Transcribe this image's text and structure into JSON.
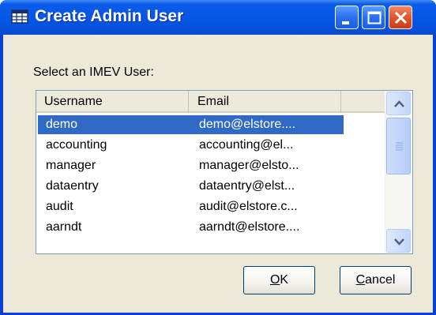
{
  "window": {
    "title": "Create Admin User",
    "title_icon": "table-icon",
    "controls": [
      "minimize",
      "maximize",
      "close"
    ]
  },
  "dialog": {
    "prompt": "Select an IMEV User:",
    "columns": [
      "Username",
      "Email"
    ],
    "rows": [
      {
        "username": "demo",
        "email": "demo@elstore....",
        "selected": true
      },
      {
        "username": "accounting",
        "email": "accounting@el...",
        "selected": false
      },
      {
        "username": "manager",
        "email": "manager@elsto...",
        "selected": false
      },
      {
        "username": "dataentry",
        "email": "dataentry@elst...",
        "selected": false
      },
      {
        "username": "audit",
        "email": "audit@elstore.c...",
        "selected": false
      },
      {
        "username": "aarndt",
        "email": "aarndt@elstore....",
        "selected": false
      }
    ],
    "ok_label": "OK",
    "ok_mnemonic": "O",
    "ok_rest": "K",
    "cancel_label": "Cancel",
    "cancel_mnemonic": "C",
    "cancel_rest": "ancel"
  },
  "colors": {
    "title_bar": "#0a5ce9",
    "selection": "#316ac5",
    "dialog_face": "#ece9d8"
  }
}
